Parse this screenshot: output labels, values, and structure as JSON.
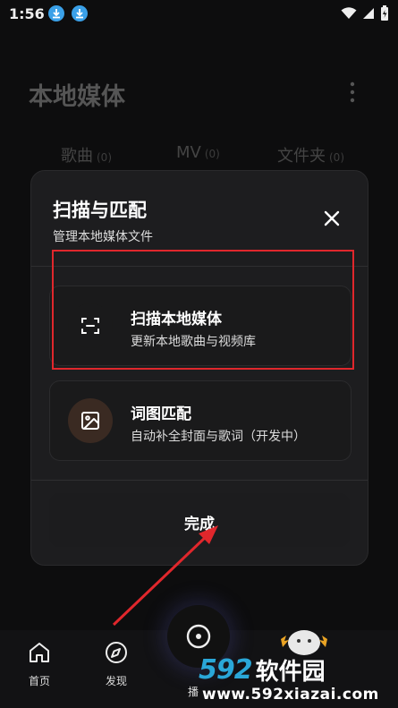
{
  "status_bar": {
    "time": "1:56"
  },
  "header": {
    "title": "本地媒体"
  },
  "tabs": [
    {
      "label": "歌曲",
      "count": "(0)"
    },
    {
      "label": "MV",
      "count": "(0)"
    },
    {
      "label": "文件夹",
      "count": "(0)"
    }
  ],
  "dialog": {
    "title": "扫描与匹配",
    "subtitle": "管理本地媒体文件",
    "options": [
      {
        "title": "扫描本地媒体",
        "desc": "更新本地歌曲与视频库",
        "icon": "scan-icon"
      },
      {
        "title": "词图匹配",
        "desc": "自动补全封面与歌词（开发中）",
        "icon": "image-icon"
      }
    ],
    "done_label": "完成"
  },
  "bottom_nav": {
    "items": [
      {
        "label": "首页",
        "icon": "home-icon"
      },
      {
        "label": "发现",
        "icon": "compass-icon"
      }
    ],
    "play_label": "播"
  },
  "watermark": {
    "brand_num": "592",
    "brand_cn": "软件园",
    "url": "www.592xiazai.com"
  },
  "colors": {
    "accent_red": "#e0272c",
    "watermark_blue": "#2aa7d8",
    "download_blue": "#3aa0e8"
  }
}
